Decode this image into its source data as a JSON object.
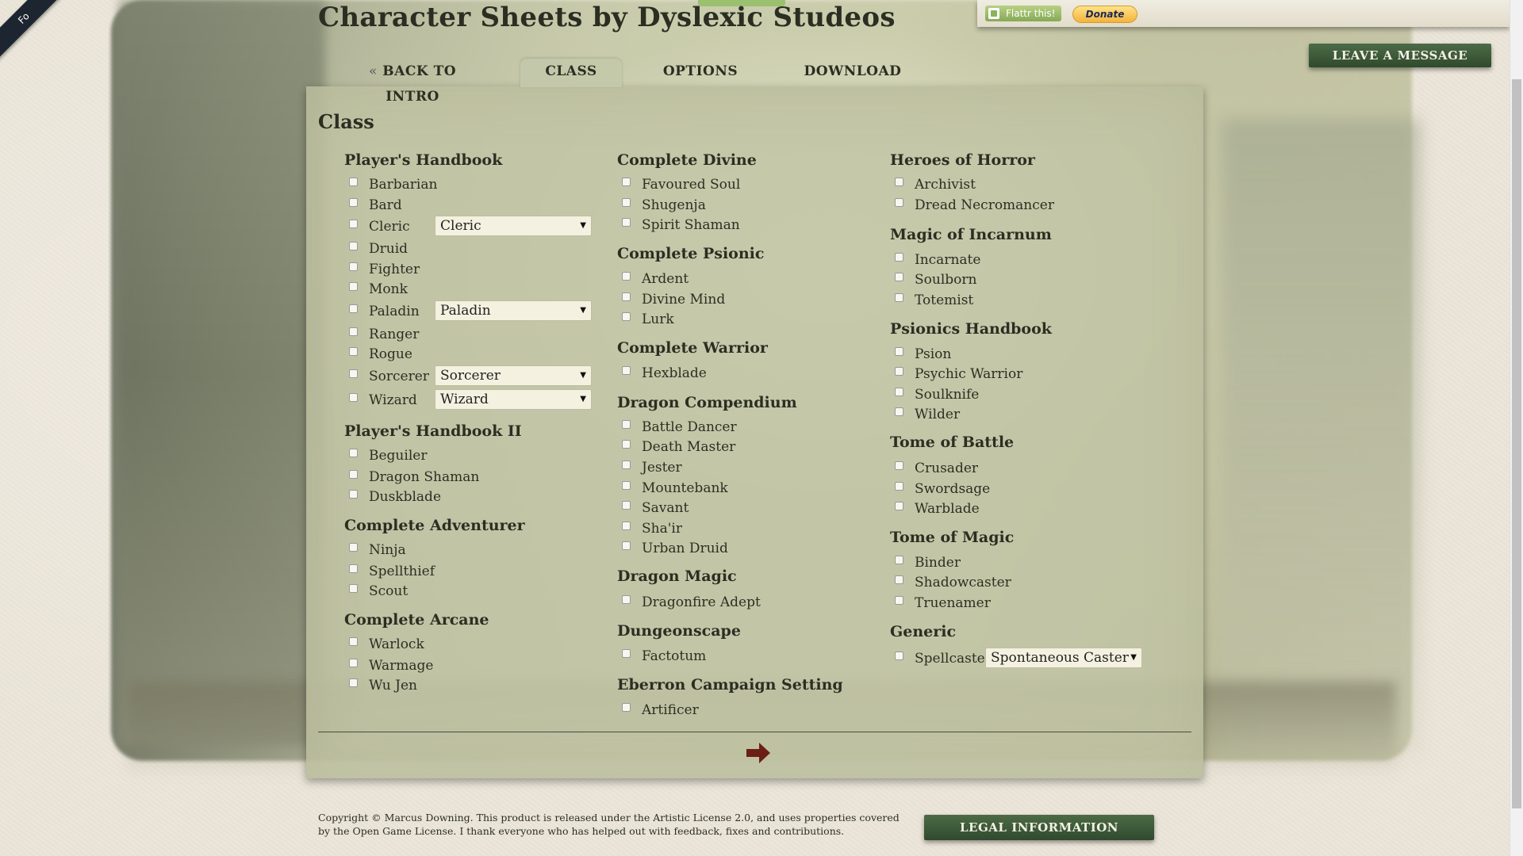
{
  "site": {
    "title": "Character Sheets by Dyslexic Studeos",
    "ribbon_text": "Fo",
    "flattr_label": "Flattr this!",
    "donate_label": "Donate",
    "leave_message_label": "LEAVE A MESSAGE"
  },
  "tabs": {
    "back": "BACK TO INTRO",
    "back_prefix": "«",
    "class": "CLASS",
    "options": "OPTIONS",
    "download": "DOWNLOAD",
    "active": "CLASS"
  },
  "panel": {
    "title": "Class"
  },
  "groups": {
    "phb": {
      "title": "Player's Handbook",
      "items": [
        "Barbarian",
        "Bard",
        "Cleric",
        "Druid",
        "Fighter",
        "Monk",
        "Paladin",
        "Ranger",
        "Rogue",
        "Sorcerer",
        "Wizard"
      ]
    },
    "phb_selects": {
      "cleric": "Cleric",
      "paladin": "Paladin",
      "sorcerer": "Sorcerer",
      "wizard": "Wizard"
    },
    "phb2": {
      "title": "Player's Handbook II",
      "items": [
        "Beguiler",
        "Dragon Shaman",
        "Duskblade"
      ]
    },
    "adventurer": {
      "title": "Complete Adventurer",
      "items": [
        "Ninja",
        "Spellthief",
        "Scout"
      ]
    },
    "arcane": {
      "title": "Complete Arcane",
      "items": [
        "Warlock",
        "Warmage",
        "Wu Jen"
      ]
    },
    "divine": {
      "title": "Complete Divine",
      "items": [
        "Favoured Soul",
        "Shugenja",
        "Spirit Shaman"
      ]
    },
    "psionic": {
      "title": "Complete Psionic",
      "items": [
        "Ardent",
        "Divine Mind",
        "Lurk"
      ]
    },
    "warrior": {
      "title": "Complete Warrior",
      "items": [
        "Hexblade"
      ]
    },
    "dragon_comp": {
      "title": "Dragon Compendium",
      "items": [
        "Battle Dancer",
        "Death Master",
        "Jester",
        "Mountebank",
        "Savant",
        "Sha'ir",
        "Urban Druid"
      ]
    },
    "dragon_magic": {
      "title": "Dragon Magic",
      "items": [
        "Dragonfire Adept"
      ]
    },
    "dungeonscape": {
      "title": "Dungeonscape",
      "items": [
        "Factotum"
      ]
    },
    "eberron": {
      "title": "Eberron Campaign Setting",
      "items": [
        "Artificer"
      ]
    },
    "horror": {
      "title": "Heroes of Horror",
      "items": [
        "Archivist",
        "Dread Necromancer"
      ]
    },
    "incarnum": {
      "title": "Magic of Incarnum",
      "items": [
        "Incarnate",
        "Soulborn",
        "Totemist"
      ]
    },
    "psionics": {
      "title": "Psionics Handbook",
      "items": [
        "Psion",
        "Psychic Warrior",
        "Soulknife",
        "Wilder"
      ]
    },
    "battle": {
      "title": "Tome of Battle",
      "items": [
        "Crusader",
        "Swordsage",
        "Warblade"
      ]
    },
    "tmagic": {
      "title": "Tome of Magic",
      "items": [
        "Binder",
        "Shadowcaster",
        "Truenamer"
      ]
    },
    "generic": {
      "title": "Generic",
      "items": [
        "Spellcaster"
      ],
      "select": "Spontaneous Caster"
    }
  },
  "footer": {
    "copyright": "Copyright © Marcus Downing. This product is released under the Artistic License 2.0, and uses properties covered by the Open Game License. I thank everyone who has helped out with feedback, fixes and contributions.",
    "legal_label": "LEGAL INFORMATION"
  },
  "colors": {
    "accent_green": "#2f4a2c",
    "panel": "#c2c5a5",
    "text": "#2c2e22",
    "next_arrow": "#6b1f14"
  },
  "icons": {
    "next": "arrow-right-icon",
    "dropdown": "triangle-down-icon"
  }
}
